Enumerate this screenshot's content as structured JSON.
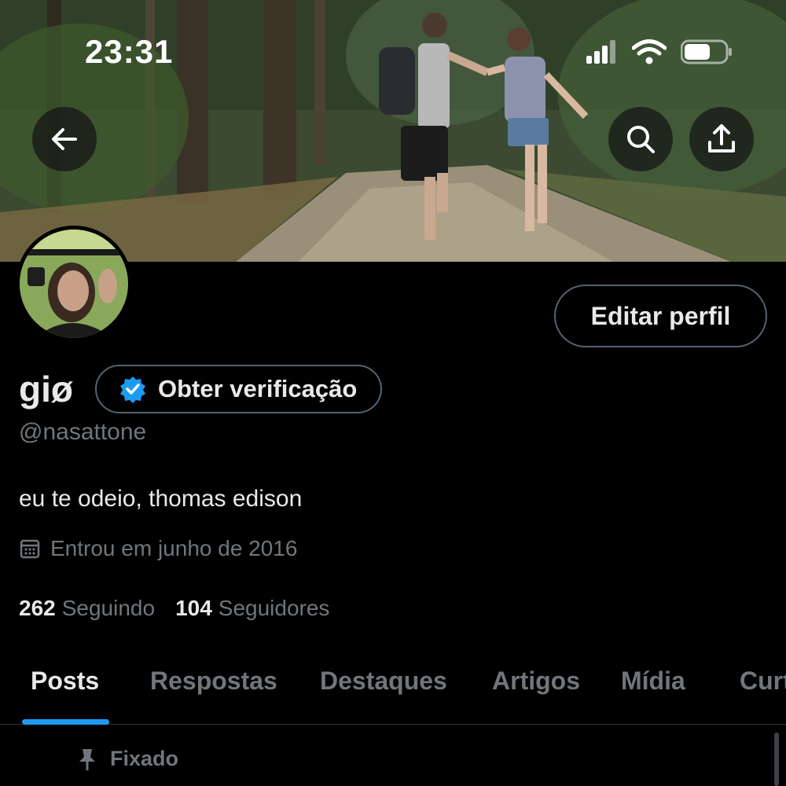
{
  "status_bar": {
    "time": "23:31"
  },
  "header": {
    "back_icon": "arrow-left-icon",
    "search_icon": "search-icon",
    "share_icon": "share-icon"
  },
  "profile": {
    "name": "giø",
    "verify_label": "Obter verificação",
    "handle": "@nasattone",
    "bio": "eu te odeio, thomas edison",
    "joined": "Entrou em junho de 2016",
    "edit_label": "Editar perfil",
    "following_count": "262",
    "following_label": "Seguindo",
    "followers_count": "104",
    "followers_label": "Seguidores"
  },
  "tabs": [
    {
      "label": "Posts",
      "active": true
    },
    {
      "label": "Respostas",
      "active": false
    },
    {
      "label": "Destaques",
      "active": false
    },
    {
      "label": "Artigos",
      "active": false
    },
    {
      "label": "Mídia",
      "active": false
    },
    {
      "label": "Curt",
      "active": false
    }
  ],
  "pinned": {
    "label": "Fixado"
  },
  "colors": {
    "accent": "#1d9bf0",
    "text_primary": "#e7e9ea",
    "text_secondary": "#71767b",
    "background": "#000000"
  }
}
